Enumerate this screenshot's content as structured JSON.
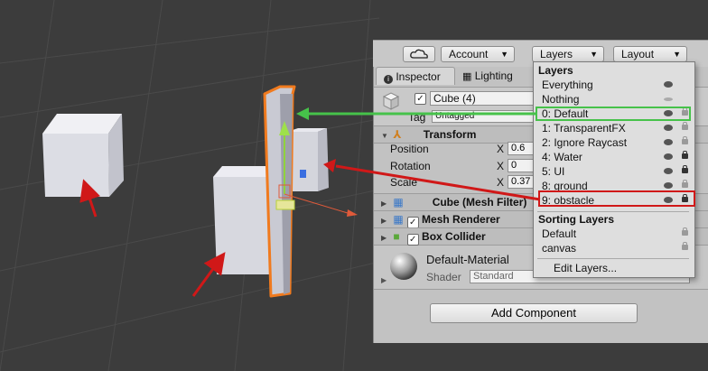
{
  "toolbar": {
    "account_label": "Account",
    "layers_label": "Layers",
    "layout_label": "Layout"
  },
  "tabs": [
    {
      "label": "Inspector"
    },
    {
      "label": "Lighting"
    }
  ],
  "object": {
    "name": "Cube (4)",
    "tag_label": "Tag",
    "tag_value": "Untagged"
  },
  "transform": {
    "title": "Transform",
    "position_label": "Position",
    "rotation_label": "Rotation",
    "scale_label": "Scale",
    "axis_x": "X",
    "position_x": "0.6",
    "rotation_x": "0",
    "scale_x": "0.37"
  },
  "components": [
    {
      "title": "Cube (Mesh Filter)"
    },
    {
      "title": "Mesh Renderer"
    },
    {
      "title": "Box Collider"
    }
  ],
  "material": {
    "name": "Default-Material",
    "shader_label": "Shader",
    "shader_value": "Standard"
  },
  "add_component_label": "Add Component",
  "layers_menu": {
    "header": "Layers",
    "items": [
      {
        "label": "Everything"
      },
      {
        "label": "Nothing"
      },
      {
        "label": "0: Default"
      },
      {
        "label": "1: TransparentFX"
      },
      {
        "label": "2: Ignore Raycast"
      },
      {
        "label": "4: Water"
      },
      {
        "label": "5: UI"
      },
      {
        "label": "8: ground"
      },
      {
        "label": "9: obstacle"
      }
    ],
    "sorting_header": "Sorting Layers",
    "sorting_items": [
      {
        "label": "Default"
      },
      {
        "label": "canvas"
      }
    ],
    "edit_label": "Edit Layers..."
  },
  "colors": {
    "scene_bg": "#3e3e3e",
    "selection": "#f07a1e",
    "highlight_green": "#46c24a",
    "highlight_red": "#d01818"
  }
}
